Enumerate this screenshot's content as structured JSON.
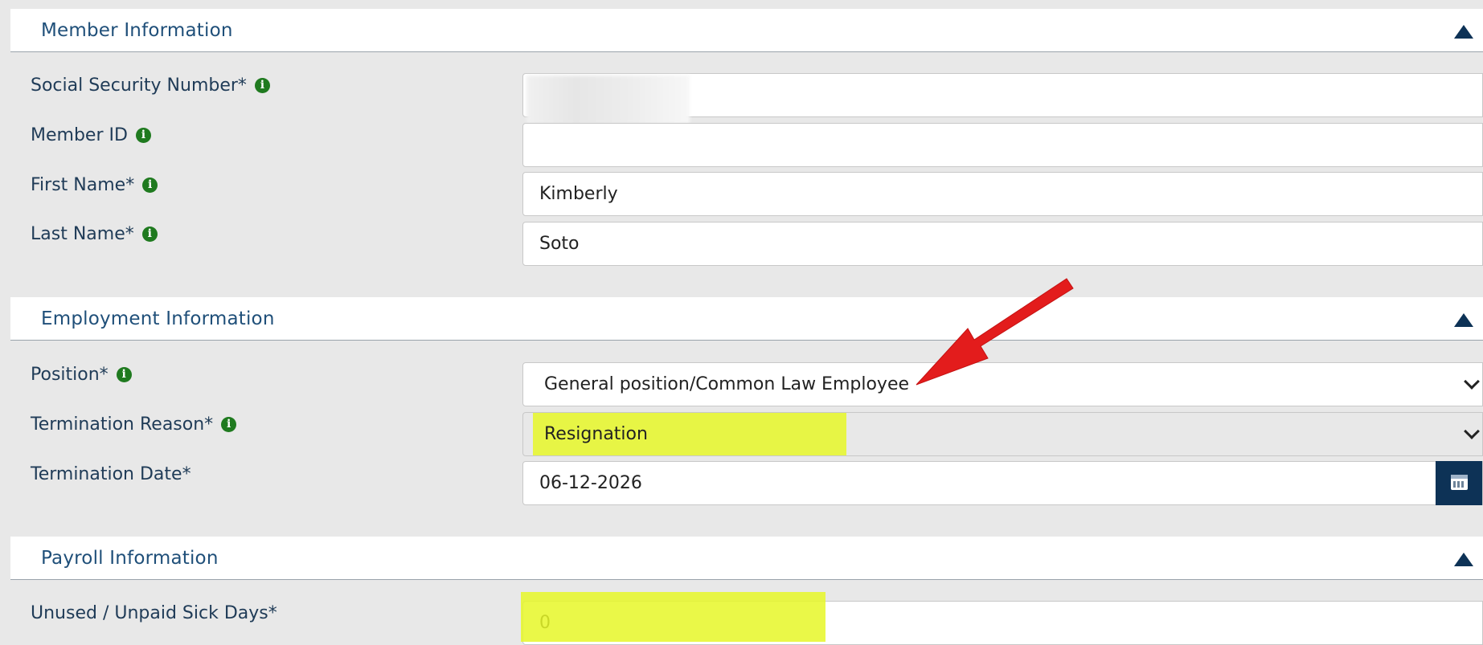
{
  "sections": {
    "member": {
      "title": "Member Information"
    },
    "employment": {
      "title": "Employment Information"
    },
    "payroll": {
      "title": "Payroll Information"
    }
  },
  "member": {
    "ssn": {
      "label": "Social Security Number*",
      "value": ""
    },
    "member_id": {
      "label": "Member ID",
      "value": ""
    },
    "first_name": {
      "label": "First Name*",
      "value": "Kimberly"
    },
    "last_name": {
      "label": "Last Name*",
      "value": "Soto"
    }
  },
  "employment": {
    "position": {
      "label": "Position*",
      "value": "General position/Common Law Employee"
    },
    "termination_reason": {
      "label": "Termination Reason*",
      "value": "Resignation"
    },
    "termination_date": {
      "label": "Termination Date*",
      "value": "06-12-2026"
    }
  },
  "payroll": {
    "sick_days": {
      "label": "Unused / Unpaid Sick Days*",
      "value": "0"
    }
  },
  "icons": {
    "info": "info-circle-icon",
    "collapse": "triangle-up-icon",
    "dropdown": "chevron-down-icon",
    "calendar": "calendar-icon"
  },
  "colors": {
    "background": "#e8e8e8",
    "header_text": "#1f4f79",
    "label_text": "#1f3b57",
    "info_icon": "#1f7a1f",
    "dark_blue": "#0d3256",
    "highlight": "#e6f728",
    "arrow": "#e31c1c"
  }
}
